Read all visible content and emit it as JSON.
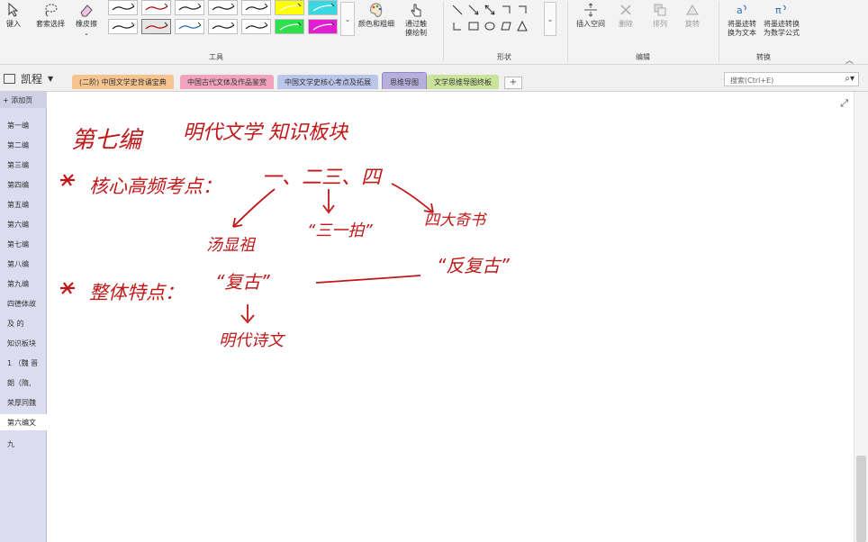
{
  "ribbon": {
    "buttons": {
      "insert_space_left": "键入",
      "lasso_select": "套索选择",
      "eraser": "橡皮擦",
      "color_thickness": "颜色和粗细",
      "draw_with_touch": "通过触摸绘制",
      "insert_space": "插入空间",
      "delete": "删除",
      "arrange": "排列",
      "rotate": "旋转",
      "ink_to_text": "将墨迹转换为文本",
      "ink_to_math": "将墨迹转换为数学公式"
    },
    "groups": {
      "tools": "工具",
      "shapes": "形状",
      "edit": "编辑",
      "convert": "转换"
    },
    "pen_colors": [
      "#1a1a1a",
      "#b00000",
      "#1a1a1a",
      "#1a1a1a",
      "#1a1a1a",
      "#ffff00",
      "#39d7e0",
      "#1a1a1a",
      "#b00000",
      "#1a5fb0",
      "#1a1a1a",
      "#1a1a1a",
      "#2ee04a",
      "#e020d0"
    ]
  },
  "notebook": {
    "name": "凯程"
  },
  "tabs": [
    {
      "label": "(二阶) 中国文学史背诵宝典",
      "color": "#f6c48f"
    },
    {
      "label": "中国古代文体及作品鉴赏",
      "color": "#f2a3bf"
    },
    {
      "label": "中国文学史核心考点及拓展",
      "color": "#b9c6ea"
    },
    {
      "label": "思维导图",
      "color": "#b7b0dd"
    },
    {
      "label": "文学思维导图终板",
      "color": "#c9e39a"
    }
  ],
  "search": {
    "placeholder": "搜索(Ctrl+E)"
  },
  "pages": {
    "add_label": "添加页",
    "items": [
      "第一编",
      "第二编",
      "第三编",
      "第四编",
      "第五编",
      "第六编",
      "第七编",
      "第八编",
      "第九编",
      "四德体故",
      "及 的",
      "知识板块",
      "1 （魏 晋",
      "朗（隋,",
      "荣厚同魏"
    ],
    "selected": "第六编文",
    "after_selected": "九"
  },
  "ink": {
    "title_left": "第七编",
    "title_right": "明代文学 知识板块",
    "bullet1_label": "核心高频考点：",
    "bullet1_items": "一、二三、四",
    "branch1": "汤显祖",
    "branch2": "“三一拍”",
    "branch3": "四大奇书",
    "bullet2_label": "整体特点：",
    "bullet2_item": "“复古”",
    "bullet2_right": "“反复古”",
    "sub_item": "明代诗文",
    "ink_color": "#c01818"
  }
}
